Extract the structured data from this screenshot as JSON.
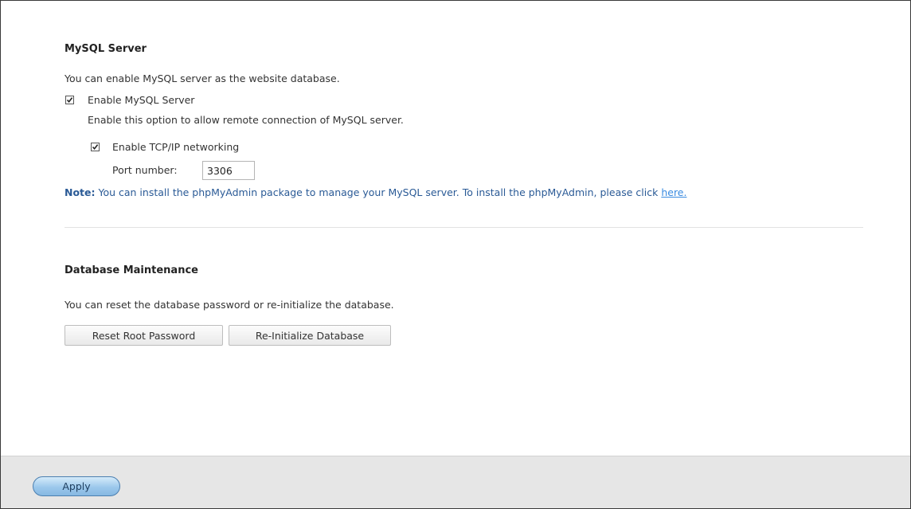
{
  "mysql_server": {
    "title": "MySQL Server",
    "description": "You can enable MySQL server as the website database.",
    "enable_checkbox": {
      "label": "Enable MySQL Server",
      "checked": true,
      "description": "Enable this option to allow remote connection of MySQL server."
    },
    "tcp_checkbox": {
      "label": "Enable TCP/IP networking",
      "checked": true
    },
    "port": {
      "label": "Port number:",
      "value": "3306"
    },
    "note": {
      "label": "Note:",
      "text": " You can install the phpMyAdmin package to manage your MySQL server. To install the phpMyAdmin, please click ",
      "link_text": "here."
    }
  },
  "database_maintenance": {
    "title": "Database Maintenance",
    "description": "You can reset the database password or re-initialize the database.",
    "reset_button_label": "Reset Root Password",
    "reinit_button_label": "Re-Initialize Database"
  },
  "footer": {
    "apply_label": "Apply"
  },
  "colors": {
    "note_text": "#2a5a96",
    "link": "#3a8be0",
    "apply_button": "#9cc8ec",
    "footer_background": "#e6e6e6"
  }
}
